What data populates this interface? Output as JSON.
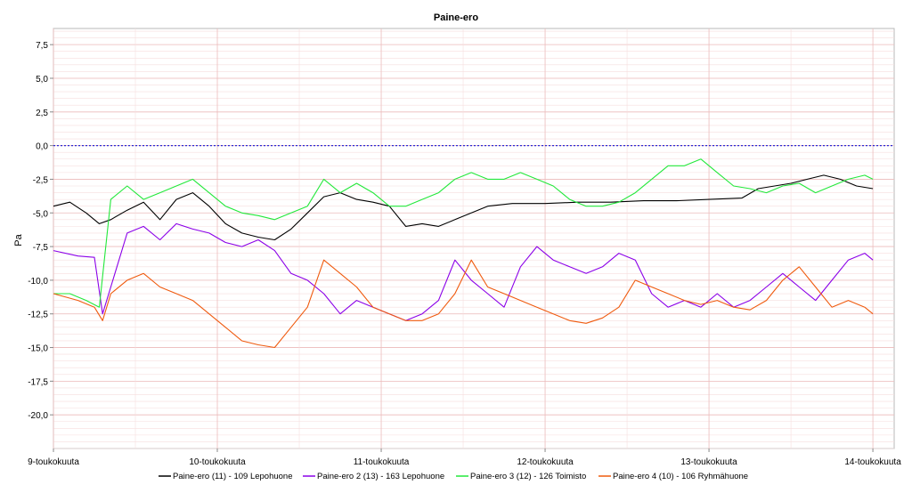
{
  "chart_data": {
    "type": "line",
    "title": "Paine-ero",
    "ylabel": "Pa",
    "xlabel": "",
    "ylim": [
      -22.5,
      8.7
    ],
    "yticks": [
      7.5,
      5.0,
      2.5,
      0.0,
      -2.5,
      -5.0,
      -7.5,
      -10.0,
      -12.5,
      -15.0,
      -17.5,
      -20.0
    ],
    "ytick_labels": [
      "7,5",
      "5,0",
      "2,5",
      "0,0",
      "-2,5",
      "-5,0",
      "-7,5",
      "-10,0",
      "-12,5",
      "-15,0",
      "-17,5",
      "-20,0"
    ],
    "xlim": [
      0,
      5.13
    ],
    "xticks": [
      0,
      1,
      2,
      3,
      4,
      5
    ],
    "xtick_labels": [
      "9-toukokuuta",
      "10-toukokuuta",
      "11-toukokuuta",
      "12-toukokuuta",
      "13-toukokuuta",
      "14-toukokuuta"
    ],
    "reference_line": {
      "y": 0.0,
      "color": "#2b2bd6"
    },
    "grid": true,
    "legend_position": "bottom",
    "series": [
      {
        "name": "Paine-ero (11) - 109 Lepohuone",
        "color": "#000000",
        "x": [
          0,
          0.1,
          0.2,
          0.28,
          0.35,
          0.45,
          0.55,
          0.65,
          0.75,
          0.85,
          0.95,
          1.05,
          1.15,
          1.25,
          1.35,
          1.45,
          1.55,
          1.65,
          1.75,
          1.85,
          1.95,
          2.05,
          2.15,
          2.25,
          2.35,
          2.45,
          2.55,
          2.65,
          2.8,
          3.0,
          3.2,
          3.4,
          3.6,
          3.8,
          4.0,
          4.2,
          4.3,
          4.4,
          4.5,
          4.6,
          4.7,
          4.8,
          4.9,
          5.0
        ],
        "y": [
          -4.5,
          -4.2,
          -5.0,
          -5.8,
          -5.5,
          -4.8,
          -4.2,
          -5.5,
          -4.0,
          -3.5,
          -4.5,
          -5.8,
          -6.5,
          -6.8,
          -7.0,
          -6.2,
          -5.0,
          -3.8,
          -3.5,
          -4.0,
          -4.2,
          -4.5,
          -6.0,
          -5.8,
          -6.0,
          -5.5,
          -5.0,
          -4.5,
          -4.3,
          -4.3,
          -4.2,
          -4.2,
          -4.1,
          -4.1,
          -4.0,
          -3.9,
          -3.2,
          -3.0,
          -2.8,
          -2.5,
          -2.2,
          -2.5,
          -3.0,
          -3.2
        ]
      },
      {
        "name": "Paine-ero 2 (13) - 163 Lepohuone",
        "color": "#8b00e8",
        "x": [
          0,
          0.15,
          0.25,
          0.3,
          0.35,
          0.45,
          0.55,
          0.65,
          0.75,
          0.85,
          0.95,
          1.05,
          1.15,
          1.25,
          1.35,
          1.45,
          1.55,
          1.65,
          1.75,
          1.85,
          1.95,
          2.05,
          2.15,
          2.25,
          2.35,
          2.45,
          2.55,
          2.65,
          2.75,
          2.85,
          2.95,
          3.05,
          3.15,
          3.25,
          3.35,
          3.45,
          3.55,
          3.65,
          3.75,
          3.85,
          3.95,
          4.05,
          4.15,
          4.25,
          4.35,
          4.45,
          4.55,
          4.65,
          4.75,
          4.85,
          4.95,
          5.0
        ],
        "y": [
          -7.8,
          -8.2,
          -8.3,
          -12.5,
          -10.5,
          -6.5,
          -6.0,
          -7.0,
          -5.8,
          -6.2,
          -6.5,
          -7.2,
          -7.5,
          -7.0,
          -7.8,
          -9.5,
          -10.0,
          -11.0,
          -12.5,
          -11.5,
          -12.0,
          -12.5,
          -13.0,
          -12.5,
          -11.5,
          -8.5,
          -10.0,
          -11.0,
          -12.0,
          -9.0,
          -7.5,
          -8.5,
          -9.0,
          -9.5,
          -9.0,
          -8.0,
          -8.5,
          -11.0,
          -12.0,
          -11.5,
          -12.0,
          -11.0,
          -12.0,
          -11.5,
          -10.5,
          -9.5,
          -10.5,
          -11.5,
          -10.0,
          -8.5,
          -8.0,
          -8.5
        ]
      },
      {
        "name": "Paine-ero 3 (12) - 126 Toimisto",
        "color": "#22e83a",
        "x": [
          0,
          0.1,
          0.2,
          0.28,
          0.35,
          0.45,
          0.55,
          0.65,
          0.75,
          0.85,
          0.95,
          1.05,
          1.15,
          1.25,
          1.35,
          1.45,
          1.55,
          1.65,
          1.75,
          1.85,
          1.95,
          2.05,
          2.15,
          2.25,
          2.35,
          2.45,
          2.55,
          2.65,
          2.75,
          2.85,
          2.95,
          3.05,
          3.15,
          3.25,
          3.35,
          3.45,
          3.55,
          3.65,
          3.75,
          3.85,
          3.95,
          4.05,
          4.15,
          4.25,
          4.35,
          4.45,
          4.55,
          4.65,
          4.75,
          4.85,
          4.95,
          5.0
        ],
        "y": [
          -11.0,
          -11.0,
          -11.5,
          -12.0,
          -4.0,
          -3.0,
          -4.0,
          -3.5,
          -3.0,
          -2.5,
          -3.5,
          -4.5,
          -5.0,
          -5.2,
          -5.5,
          -5.0,
          -4.5,
          -2.5,
          -3.5,
          -2.8,
          -3.5,
          -4.5,
          -4.5,
          -4.0,
          -3.5,
          -2.5,
          -2.0,
          -2.5,
          -2.5,
          -2.0,
          -2.5,
          -3.0,
          -4.0,
          -4.5,
          -4.5,
          -4.2,
          -3.5,
          -2.5,
          -1.5,
          -1.5,
          -1.0,
          -2.0,
          -3.0,
          -3.2,
          -3.5,
          -3.0,
          -2.8,
          -3.5,
          -3.0,
          -2.5,
          -2.2,
          -2.5
        ]
      },
      {
        "name": "Paine-ero 4 (10) - 106 Ryhmähuone",
        "color": "#ef5a0e",
        "x": [
          0,
          0.15,
          0.25,
          0.3,
          0.35,
          0.45,
          0.55,
          0.65,
          0.75,
          0.85,
          0.95,
          1.05,
          1.15,
          1.25,
          1.35,
          1.45,
          1.55,
          1.65,
          1.75,
          1.85,
          1.95,
          2.05,
          2.15,
          2.25,
          2.35,
          2.45,
          2.55,
          2.65,
          2.75,
          2.85,
          2.95,
          3.05,
          3.15,
          3.25,
          3.35,
          3.45,
          3.55,
          3.65,
          3.75,
          3.85,
          3.95,
          4.05,
          4.15,
          4.25,
          4.35,
          4.45,
          4.55,
          4.65,
          4.75,
          4.85,
          4.95,
          5.0
        ],
        "y": [
          -11.0,
          -11.5,
          -12.0,
          -13.0,
          -11.0,
          -10.0,
          -9.5,
          -10.5,
          -11.0,
          -11.5,
          -12.5,
          -13.5,
          -14.5,
          -14.8,
          -15.0,
          -13.5,
          -12.0,
          -8.5,
          -9.5,
          -10.5,
          -12.0,
          -12.5,
          -13.0,
          -13.0,
          -12.5,
          -11.0,
          -8.5,
          -10.5,
          -11.0,
          -11.5,
          -12.0,
          -12.5,
          -13.0,
          -13.2,
          -12.8,
          -12.0,
          -10.0,
          -10.5,
          -11.0,
          -11.5,
          -11.8,
          -11.5,
          -12.0,
          -12.2,
          -11.5,
          -10.0,
          -9.0,
          -10.5,
          -12.0,
          -11.5,
          -12.0,
          -12.5
        ]
      }
    ]
  }
}
